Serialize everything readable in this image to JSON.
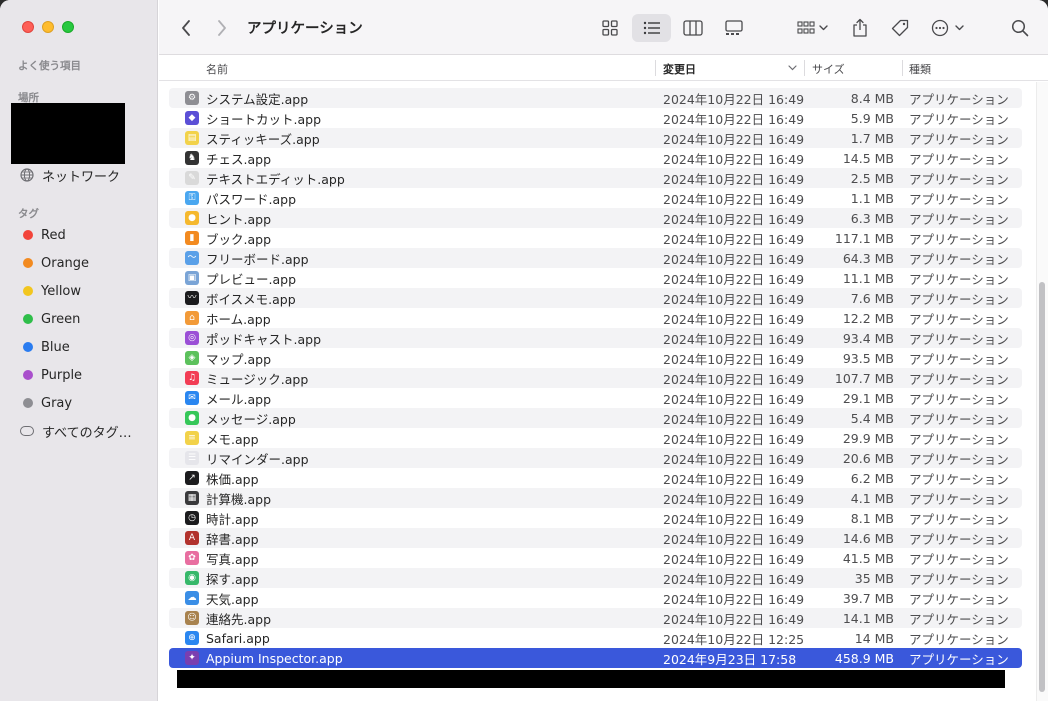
{
  "toolbar": {
    "title": "アプリケーション"
  },
  "sidebar": {
    "favorites_header": "よく使う項目",
    "locations_header": "場所",
    "network_label": "ネットワーク",
    "tags_header": "タグ",
    "tags": [
      {
        "label": "Red",
        "color": "#f2443a"
      },
      {
        "label": "Orange",
        "color": "#f28a20"
      },
      {
        "label": "Yellow",
        "color": "#f2c61f"
      },
      {
        "label": "Green",
        "color": "#2fbe4a"
      },
      {
        "label": "Blue",
        "color": "#2a7cf0"
      },
      {
        "label": "Purple",
        "color": "#a94fcc"
      },
      {
        "label": "Gray",
        "color": "#8e8e93"
      }
    ],
    "all_tags_label": "すべてのタグ…"
  },
  "columns": {
    "name": "名前",
    "date": "変更日",
    "size": "サイズ",
    "kind": "種類"
  },
  "files": [
    {
      "name": "システム設定.app",
      "date": "2024年10月22日 16:49",
      "size": "8.4 MB",
      "kind": "アプリケーション",
      "icon": "gear-icon",
      "color": "#8e8e93"
    },
    {
      "name": "ショートカット.app",
      "date": "2024年10月22日 16:49",
      "size": "5.9 MB",
      "kind": "アプリケーション",
      "icon": "shortcuts-icon",
      "color": "#5b4fd6"
    },
    {
      "name": "スティッキーズ.app",
      "date": "2024年10月22日 16:49",
      "size": "1.7 MB",
      "kind": "アプリケーション",
      "icon": "sticky-note-icon",
      "color": "#f2d24a"
    },
    {
      "name": "チェス.app",
      "date": "2024年10月22日 16:49",
      "size": "14.5 MB",
      "kind": "アプリケーション",
      "icon": "chess-icon",
      "color": "#333333"
    },
    {
      "name": "テキストエディット.app",
      "date": "2024年10月22日 16:49",
      "size": "2.5 MB",
      "kind": "アプリケーション",
      "icon": "text-edit-icon",
      "color": "#d9d9d9"
    },
    {
      "name": "パスワード.app",
      "date": "2024年10月22日 16:49",
      "size": "1.1 MB",
      "kind": "アプリケーション",
      "icon": "key-icon",
      "color": "#4aa7f0"
    },
    {
      "name": "ヒント.app",
      "date": "2024年10月22日 16:49",
      "size": "6.3 MB",
      "kind": "アプリケーション",
      "icon": "lightbulb-icon",
      "color": "#f5b82e"
    },
    {
      "name": "ブック.app",
      "date": "2024年10月22日 16:49",
      "size": "117.1 MB",
      "kind": "アプリケーション",
      "icon": "book-icon",
      "color": "#f28a20"
    },
    {
      "name": "フリーボード.app",
      "date": "2024年10月22日 16:49",
      "size": "64.3 MB",
      "kind": "アプリケーション",
      "icon": "freeform-icon",
      "color": "#5aa0e8"
    },
    {
      "name": "プレビュー.app",
      "date": "2024年10月22日 16:49",
      "size": "11.1 MB",
      "kind": "アプリケーション",
      "icon": "preview-icon",
      "color": "#7aa4d6"
    },
    {
      "name": "ボイスメモ.app",
      "date": "2024年10月22日 16:49",
      "size": "7.6 MB",
      "kind": "アプリケーション",
      "icon": "waveform-icon",
      "color": "#1c1c1e"
    },
    {
      "name": "ホーム.app",
      "date": "2024年10月22日 16:49",
      "size": "12.2 MB",
      "kind": "アプリケーション",
      "icon": "house-icon",
      "color": "#f29a38"
    },
    {
      "name": "ポッドキャスト.app",
      "date": "2024年10月22日 16:49",
      "size": "93.4 MB",
      "kind": "アプリケーション",
      "icon": "podcast-icon",
      "color": "#9b4fd6"
    },
    {
      "name": "マップ.app",
      "date": "2024年10月22日 16:49",
      "size": "93.5 MB",
      "kind": "アプリケーション",
      "icon": "map-icon",
      "color": "#5cc15c"
    },
    {
      "name": "ミュージック.app",
      "date": "2024年10月22日 16:49",
      "size": "107.7 MB",
      "kind": "アプリケーション",
      "icon": "music-note-icon",
      "color": "#f23d55"
    },
    {
      "name": "メール.app",
      "date": "2024年10月22日 16:49",
      "size": "29.1 MB",
      "kind": "アプリケーション",
      "icon": "envelope-icon",
      "color": "#2a86f0"
    },
    {
      "name": "メッセージ.app",
      "date": "2024年10月22日 16:49",
      "size": "5.4 MB",
      "kind": "アプリケーション",
      "icon": "speech-bubble-icon",
      "color": "#36c759"
    },
    {
      "name": "メモ.app",
      "date": "2024年10月22日 16:49",
      "size": "29.9 MB",
      "kind": "アプリケーション",
      "icon": "notes-icon",
      "color": "#f2d24a"
    },
    {
      "name": "リマインダー.app",
      "date": "2024年10月22日 16:49",
      "size": "20.6 MB",
      "kind": "アプリケーション",
      "icon": "checklist-icon",
      "color": "#e5e5ea"
    },
    {
      "name": "株価.app",
      "date": "2024年10月22日 16:49",
      "size": "6.2 MB",
      "kind": "アプリケーション",
      "icon": "stocks-chart-icon",
      "color": "#1c1c1e"
    },
    {
      "name": "計算機.app",
      "date": "2024年10月22日 16:49",
      "size": "4.1 MB",
      "kind": "アプリケーション",
      "icon": "calculator-icon",
      "color": "#3a3a3c"
    },
    {
      "name": "時計.app",
      "date": "2024年10月22日 16:49",
      "size": "8.1 MB",
      "kind": "アプリケーション",
      "icon": "clock-icon",
      "color": "#1c1c1e"
    },
    {
      "name": "辞書.app",
      "date": "2024年10月22日 16:49",
      "size": "14.6 MB",
      "kind": "アプリケーション",
      "icon": "dictionary-icon",
      "color": "#b2322d"
    },
    {
      "name": "写真.app",
      "date": "2024年10月22日 16:49",
      "size": "41.5 MB",
      "kind": "アプリケーション",
      "icon": "photos-flower-icon",
      "color": "#e86ea0"
    },
    {
      "name": "探す.app",
      "date": "2024年10月22日 16:49",
      "size": "35 MB",
      "kind": "アプリケーション",
      "icon": "find-my-icon",
      "color": "#36b86a"
    },
    {
      "name": "天気.app",
      "date": "2024年10月22日 16:49",
      "size": "39.7 MB",
      "kind": "アプリケーション",
      "icon": "weather-cloud-icon",
      "color": "#3a8ee6"
    },
    {
      "name": "連絡先.app",
      "date": "2024年10月22日 16:49",
      "size": "14.1 MB",
      "kind": "アプリケーション",
      "icon": "contacts-icon",
      "color": "#a8824e"
    },
    {
      "name": "Safari.app",
      "date": "2024年10月22日 12:25",
      "size": "14 MB",
      "kind": "アプリケーション",
      "icon": "compass-icon",
      "color": "#2a86f0"
    },
    {
      "name": "Appium Inspector.app",
      "date": "2024年9月23日 17:58",
      "size": "458.9 MB",
      "kind": "アプリケーション",
      "icon": "appium-bird-icon",
      "color": "#7a3fb0",
      "selected": true
    }
  ]
}
